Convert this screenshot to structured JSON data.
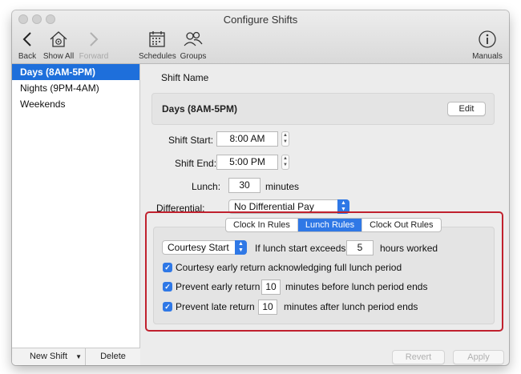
{
  "window": {
    "title": "Configure Shifts"
  },
  "toolbar": {
    "back": "Back",
    "show_all": "Show All",
    "forward": "Forward",
    "schedules": "Schedules",
    "groups": "Groups",
    "manuals": "Manuals"
  },
  "sidebar": {
    "items": [
      {
        "label": "Days (8AM-5PM)",
        "selected": true
      },
      {
        "label": "Nights (9PM-4AM)",
        "selected": false
      },
      {
        "label": "Weekends",
        "selected": false
      }
    ],
    "new_shift": "New Shift",
    "delete": "Delete"
  },
  "form": {
    "shift_name_label": "Shift Name",
    "shift_name_value": "Days (8AM-5PM)",
    "edit": "Edit",
    "shift_start_label": "Shift Start:",
    "shift_start_value": "8:00 AM",
    "shift_end_label": "Shift End:",
    "shift_end_value": "5:00 PM",
    "lunch_label": "Lunch:",
    "lunch_value": "30",
    "lunch_unit": "minutes",
    "differential_label": "Differential:",
    "differential_value": "No Differential Pay"
  },
  "rules": {
    "tabs": [
      {
        "label": "Clock In Rules",
        "active": false
      },
      {
        "label": "Lunch Rules",
        "active": true
      },
      {
        "label": "Clock Out Rules",
        "active": false
      }
    ],
    "courtesy_select": "Courtesy Start",
    "if_exceeds_label": "If lunch start exceeds",
    "exceeds_value": "5",
    "hours_worked": "hours worked",
    "courtesy_return": {
      "checked": true,
      "label": "Courtesy early return acknowledging full lunch period"
    },
    "prevent_early": {
      "checked": true,
      "label": "Prevent early return",
      "value": "10",
      "suffix": "minutes before lunch period ends"
    },
    "prevent_late": {
      "checked": true,
      "label": "Prevent late return",
      "value": "10",
      "suffix": "minutes after lunch period ends"
    }
  },
  "footer": {
    "revert": "Revert",
    "apply": "Apply"
  },
  "colors": {
    "selection": "#1e6fdb",
    "accent": "#2f78e6",
    "highlight_border": "#c0212e"
  }
}
